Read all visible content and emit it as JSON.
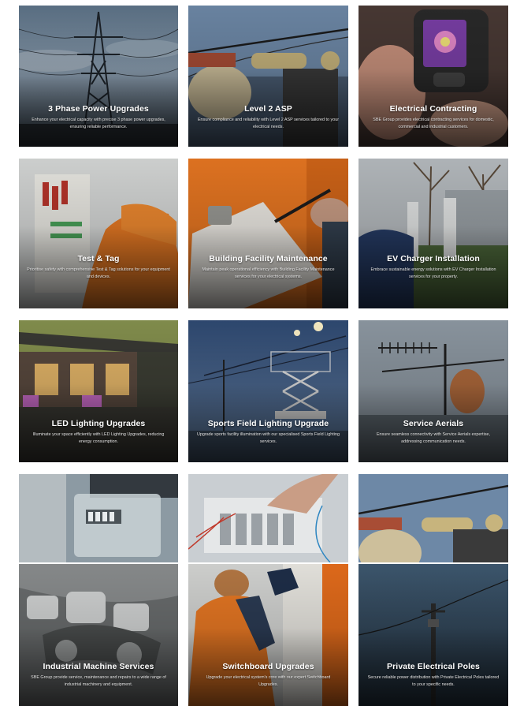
{
  "services": [
    {
      "title": "3 Phase Power Upgrades",
      "desc": "Enhance your electrical capacity with precise 3 phase power upgrades, ensuring reliable performance.",
      "icon": "power-pylon-icon"
    },
    {
      "title": "Level 2 ASP",
      "desc": "Ensure compliance and reliability with Level 2 ASP services tailored to your electrical needs.",
      "icon": "lineworker-icon"
    },
    {
      "title": "Electrical Contracting",
      "desc": "SBE Group provides electrical contracting services for domestic, commercial and industrial customers.",
      "icon": "thermal-camera-icon"
    },
    {
      "title": "Test & Tag",
      "desc": "Prioritise safety with comprehensive Test & Tag solutions for your equipment and devices.",
      "icon": "test-tag-icon"
    },
    {
      "title": "Building Facility Maintenance",
      "desc": "Maintain peak operational efficiency with Building Facility Maintenance services for your electrical systems.",
      "icon": "clipboard-icon"
    },
    {
      "title": "EV Charger Installation",
      "desc": "Embrace sustainable energy solutions with EV Charger Installation services for your property.",
      "icon": "ev-charger-icon"
    },
    {
      "title": "LED Lighting Upgrades",
      "desc": "Illuminate your space efficiently with LED Lighting Upgrades, reducing energy consumption.",
      "icon": "house-lighting-icon"
    },
    {
      "title": "Sports Field Lighting Upgrade",
      "desc": "Upgrade sports facility illumination with our specialised Sports Field Lighting services.",
      "icon": "scissor-lift-icon"
    },
    {
      "title": "Service Aerials",
      "desc": "Ensure seamless connectivity with Service Aerials expertise, addressing communication needs.",
      "icon": "antenna-icon"
    },
    {
      "title": "Industrial Machine Services",
      "desc": "SBE Group provide service, maintenance and repairs to a wide range of industrial machinery and equipment.",
      "icon": "industrial-machine-icon"
    },
    {
      "title": "Switchboard Upgrades",
      "desc": "Upgrade your electrical system's core with our expert Switchboard Upgrades.",
      "icon": "switchboard-icon"
    },
    {
      "title": "Private Electrical Poles",
      "desc": "Secure reliable power distribution with Private Electrical Poles tailored to your specific needs.",
      "icon": "power-pole-icon"
    }
  ],
  "strip_photos": [
    {
      "icon": "electric-meter-icon"
    },
    {
      "icon": "wiring-panel-icon"
    },
    {
      "icon": "lineworker-icon"
    }
  ]
}
